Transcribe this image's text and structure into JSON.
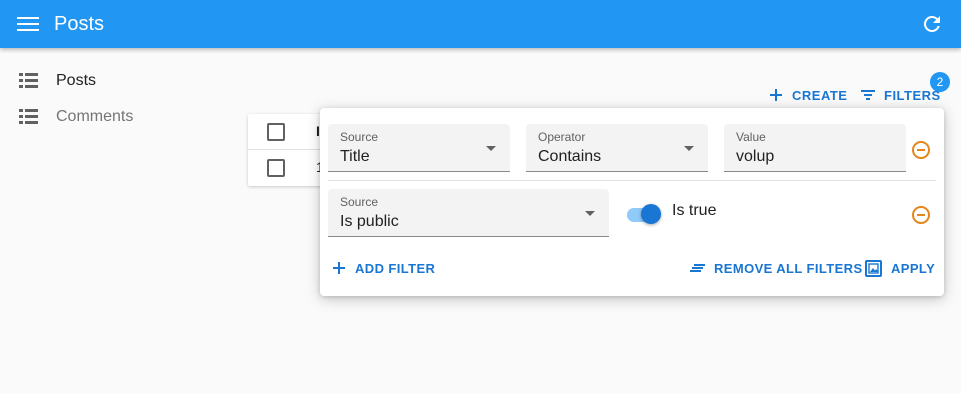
{
  "appbar": {
    "title": "Posts",
    "menu_icon": "menu-icon",
    "refresh_icon": "refresh-icon",
    "color": "#2196f3"
  },
  "sidebar": {
    "items": [
      {
        "label": "Posts",
        "icon": "list-icon"
      },
      {
        "label": "Comments",
        "icon": "list-icon"
      }
    ]
  },
  "toolbar": {
    "create_label": "CREATE",
    "filters_label": "FILTERS",
    "filters_badge": "2"
  },
  "table": {
    "header_text": "I",
    "row_text": "1"
  },
  "filter_panel": {
    "row1": {
      "source_label": "Source",
      "source_value": "Title",
      "operator_label": "Operator",
      "operator_value": "Contains",
      "value_label": "Value",
      "value_value": "volup"
    },
    "row2": {
      "source_label": "Source",
      "source_value": "Is public",
      "switch_label": "Is true",
      "switch_on": true
    },
    "add_filter_label": "ADD FILTER",
    "remove_all_label": "REMOVE ALL FILTERS",
    "apply_label": "APPLY"
  },
  "colors": {
    "accent": "#1976d2",
    "remove": "#e6851b"
  }
}
